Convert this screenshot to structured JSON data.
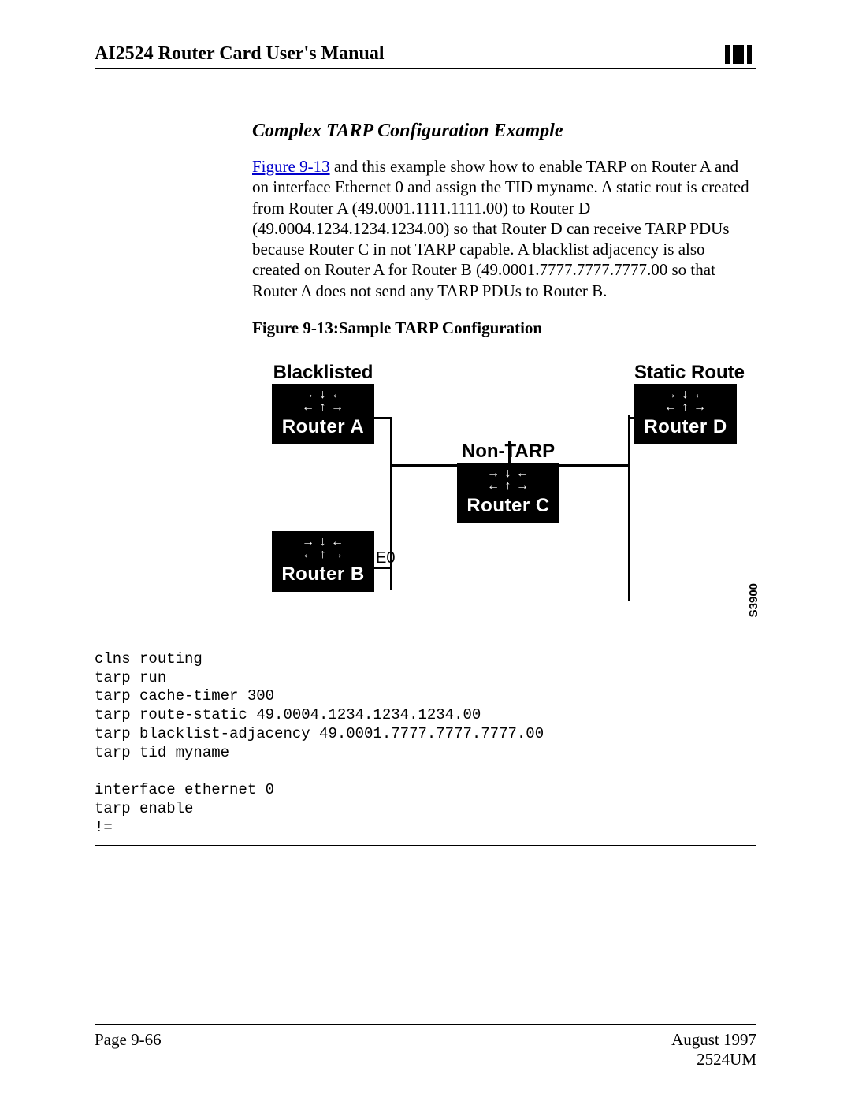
{
  "header": {
    "title": "AI2524 Router Card User's Manual"
  },
  "section": {
    "title": "Complex TARP Configuration Example",
    "figure_link": "Figure 9-13",
    "body_after_link": " and this example show how to enable TARP on Router A and on interface Ethernet 0 and assign the TID myname. A static rout is created from Router A (49.0001.1111.1111.00) to Router D (49.0004.1234.1234.1234.00) so that Router D can receive TARP PDUs because Router C in not TARP capable. A blacklist adjacency is also created on Router A for Router B (49.0001.7777.7777.7777.00 so that Router A does not send any TARP PDUs to Router B.",
    "figure_caption": "Figure 9-13:Sample TARP Configuration"
  },
  "diagram": {
    "label_blacklisted": "Blacklisted",
    "label_static_route": "Static Route",
    "label_non_tarp": "Non-TARP",
    "router_a": "Router A",
    "router_b": "Router B",
    "router_c": "Router C",
    "router_d": "Router D",
    "e0": "E0",
    "code_number": "S3900"
  },
  "code": "clns routing\ntarp run\ntarp cache-timer 300\ntarp route-static 49.0004.1234.1234.1234.00\ntarp blacklist-adjacency 49.0001.7777.7777.7777.00\ntarp tid myname\n\ninterface ethernet 0\ntarp enable\n!=",
  "footer": {
    "page": "Page 9-66",
    "date": "August 1997",
    "doc": "2524UM"
  }
}
